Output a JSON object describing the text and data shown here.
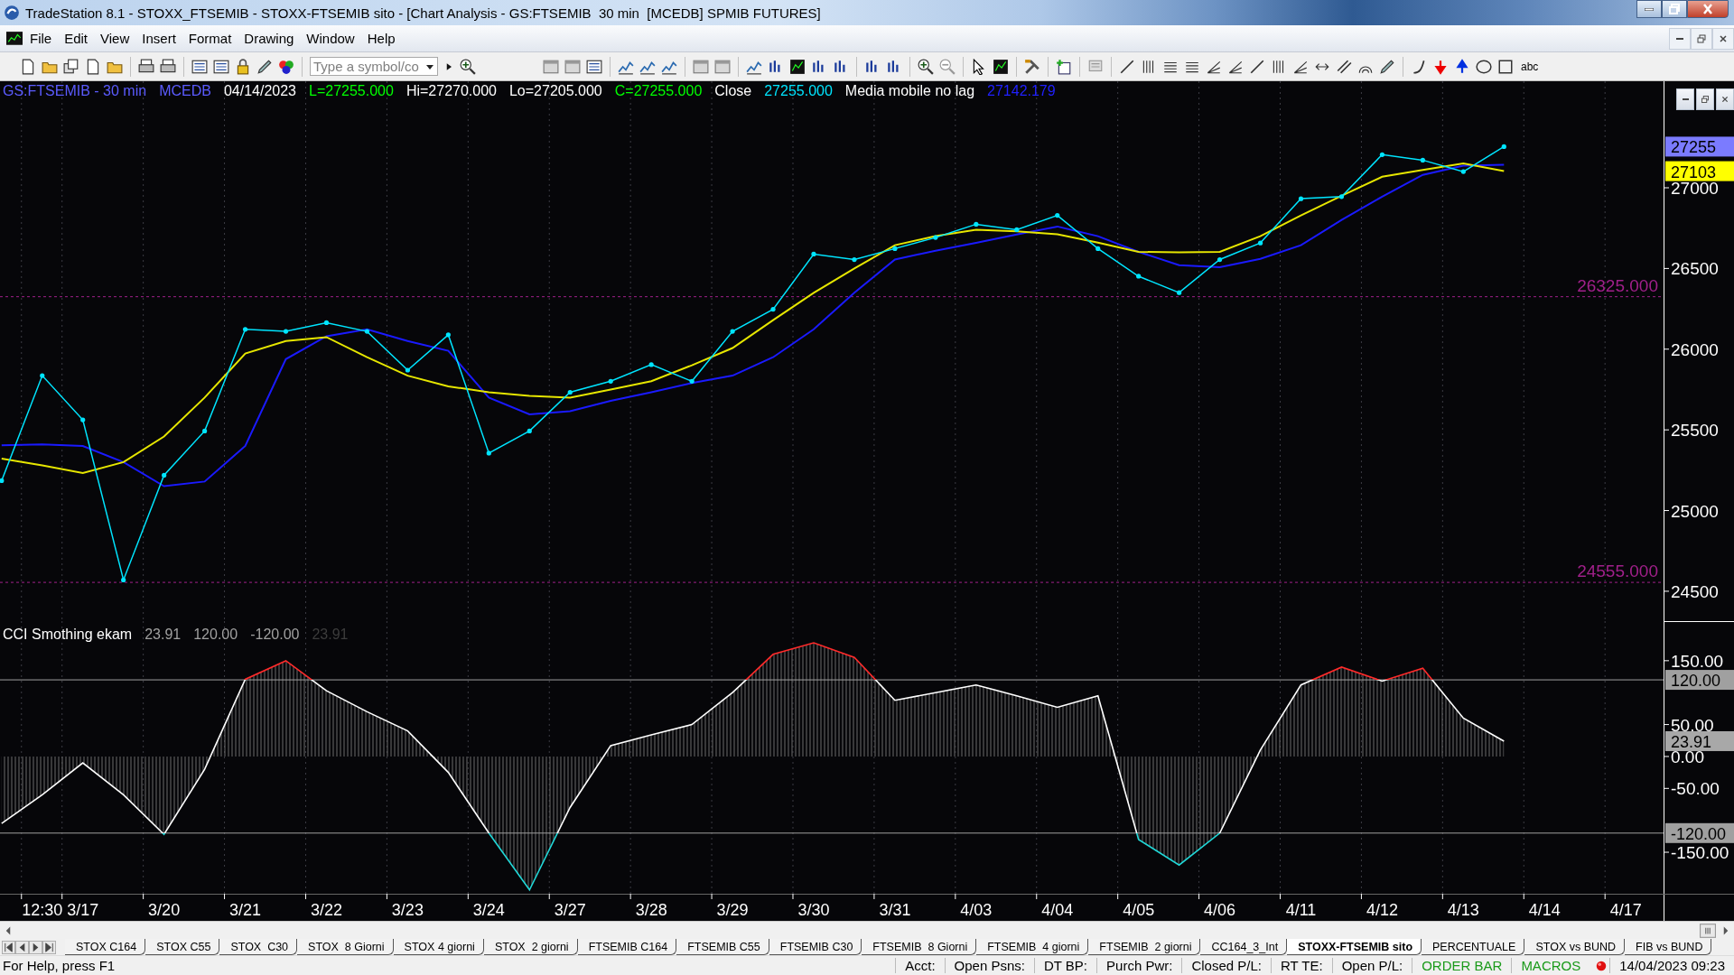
{
  "window": {
    "title": "TradeStation 8.1 - STOXX_FTSEMIB - STOXX-FTSEMIB sito - [Chart Analysis - GS:FTSEMIB  30 min  [MCEDB] SPMIB FUTURES]"
  },
  "menu": [
    "File",
    "Edit",
    "View",
    "Insert",
    "Format",
    "Drawing",
    "Window",
    "Help"
  ],
  "toolbar": {
    "symbol_field": {
      "placeholder": "Type a symbol/co"
    },
    "text_tool": "abc"
  },
  "price_panel": {
    "header": [
      {
        "text": "GS:FTSEMIB - 30 min",
        "color": "#5b5bff"
      },
      {
        "text": "MCEDB",
        "color": "#5b5bff"
      },
      {
        "text": "04/14/2023",
        "color": "#ffffff"
      },
      {
        "text": "L=27255.000",
        "color": "#00ff00"
      },
      {
        "text": "Hi=27270.000",
        "color": "#ffffff"
      },
      {
        "text": "Lo=27205.000",
        "color": "#ffffff"
      },
      {
        "text": "C=27255.000",
        "color": "#00ff00"
      },
      {
        "text": "Close",
        "color": "#ffffff"
      },
      {
        "text": "27255.000",
        "color": "#00e5ff"
      },
      {
        "text": "Media mobile no lag",
        "color": "#ffffff"
      },
      {
        "text": "27142.179",
        "color": "#2020ff"
      }
    ],
    "value_badges": [
      {
        "text": "27255",
        "color": "#7b7bff"
      },
      {
        "text": "27103",
        "color": "#ffff00"
      }
    ],
    "chart_data": {
      "type": "line",
      "ylim": [
        24315,
        27660
      ],
      "yticks": [
        24500,
        25000,
        25500,
        26000,
        26500,
        27000
      ],
      "categories": [
        null,
        null,
        null,
        null,
        null,
        null,
        null,
        null,
        null,
        null,
        null,
        null,
        null,
        null,
        null,
        null,
        null,
        null,
        null,
        null,
        null,
        null,
        null,
        null,
        null,
        null,
        null,
        null,
        null,
        null,
        null,
        null,
        null,
        null,
        null,
        null,
        null,
        null,
        null,
        null,
        null
      ],
      "series": [
        {
          "color": "#00e5ff",
          "values": [
            25185,
            25836,
            25562,
            24570,
            25219,
            25493,
            26123,
            26110,
            26164,
            26110,
            25870,
            26089,
            25356,
            25493,
            25733,
            25801,
            25904,
            25801,
            26110,
            26247,
            26589,
            26555,
            26623,
            26692,
            26774,
            26740,
            26829,
            26623,
            26452,
            26350,
            26555,
            26658,
            26932,
            26945,
            27205,
            27171,
            27100,
            27255,
            null,
            null,
            null
          ]
        },
        {
          "color": "#e6e600",
          "values": [
            25322,
            25280,
            25233,
            25300,
            25459,
            25700,
            25973,
            26050,
            26075,
            25950,
            25836,
            25770,
            25733,
            25710,
            25699,
            25750,
            25801,
            25900,
            26007,
            26180,
            26349,
            26500,
            26644,
            26700,
            26740,
            26730,
            26712,
            26660,
            26603,
            26600,
            26603,
            26700,
            26829,
            26950,
            27068,
            27110,
            27151,
            27103,
            null,
            null,
            null
          ]
        },
        {
          "color": "#1a1aff",
          "values": [
            25404,
            25410,
            25400,
            25300,
            25151,
            25180,
            25400,
            25938,
            26080,
            26123,
            26050,
            25990,
            25700,
            25596,
            25616,
            25680,
            25733,
            25790,
            25836,
            25950,
            26123,
            26350,
            26555,
            26610,
            26658,
            26710,
            26760,
            26700,
            26603,
            26520,
            26507,
            26560,
            26644,
            26800,
            26945,
            27080,
            27137,
            27142,
            null,
            null,
            null
          ]
        }
      ],
      "ref_lines": [
        {
          "axis": "y",
          "value": 26325,
          "label": "26325.000",
          "color": "#a0208a"
        },
        {
          "axis": "y",
          "value": 24555,
          "label": "24555.000",
          "color": "#a0208a"
        }
      ]
    }
  },
  "cci_panel": {
    "header": [
      {
        "text": "CCI Smothing ekam",
        "color": "#ffffff"
      },
      {
        "text": "23.91",
        "color": "#a0a0a0"
      },
      {
        "text": "120.00",
        "color": "#a0a0a0"
      },
      {
        "text": "-120.00",
        "color": "#a0a0a0"
      },
      {
        "text": "23.91",
        "color": "#3c3c3c"
      }
    ],
    "value_badges": [
      {
        "text": "23.91",
        "color": "#a8a8a8"
      }
    ],
    "chart_data": {
      "type": "area",
      "ylim": [
        -215,
        212
      ],
      "categories": [
        null,
        "12:30",
        "3/17",
        null,
        "3/20",
        null,
        "3/21",
        null,
        "3/22",
        null,
        "3/23",
        null,
        "3/24",
        null,
        "3/27",
        null,
        "3/28",
        null,
        "3/29",
        null,
        "3/30",
        null,
        "3/31",
        null,
        "4/03",
        null,
        "4/04",
        null,
        "4/05",
        null,
        "4/06",
        null,
        "4/11",
        null,
        "4/12",
        null,
        "4/13",
        null,
        "4/14",
        null,
        "4/17"
      ],
      "yticks": [
        {
          "value": 150,
          "label": "150.00"
        },
        {
          "value": 50,
          "label": "50.00"
        },
        {
          "value": 0,
          "label": "0.00"
        },
        {
          "value": -50,
          "label": "-50.00"
        },
        {
          "value": -150,
          "label": "-150.00"
        }
      ],
      "series": [
        {
          "color": "#ffffff",
          "values": [
            -105,
            -60,
            -10,
            -60,
            -122,
            -20,
            121,
            150,
            103,
            70,
            40,
            -25,
            -120,
            -209,
            -80,
            17,
            34,
            50,
            100,
            160,
            178,
            155,
            88,
            100,
            112,
            95,
            77,
            95,
            -130,
            -170,
            -120,
            10,
            112,
            140,
            118,
            138,
            60,
            24,
            null,
            null,
            null
          ]
        }
      ],
      "ref_lines": [
        {
          "axis": "y",
          "value": 120,
          "label": "120.00",
          "color": "#a0a0a0"
        },
        {
          "axis": "y",
          "value": -120,
          "label": "-120.00",
          "color": "#a0a0a0"
        }
      ]
    }
  },
  "sheet_tabs": [
    {
      "label": "STOX C164",
      "selected": false
    },
    {
      "label": "STOX C55",
      "selected": false
    },
    {
      "label": "STOX  C30",
      "selected": false
    },
    {
      "label": "STOX  8 Giorni",
      "selected": false
    },
    {
      "label": "STOX 4 giorni",
      "selected": false
    },
    {
      "label": "STOX  2 giorni",
      "selected": false
    },
    {
      "label": "FTSEMIB C164",
      "selected": false
    },
    {
      "label": "FTSEMIB C55",
      "selected": false
    },
    {
      "label": "FTSEMIB C30",
      "selected": false
    },
    {
      "label": "FTSEMIB  8 Giorni",
      "selected": false
    },
    {
      "label": "FTSEMIB  4 giorni",
      "selected": false
    },
    {
      "label": "FTSEMIB  2 giorni",
      "selected": false
    },
    {
      "label": "CC164_3_Int",
      "selected": false
    },
    {
      "label": "STOXX-FTSEMIB sito",
      "selected": true
    },
    {
      "label": "PERCENTUALE",
      "selected": false
    },
    {
      "label": "STOX vs BUND",
      "selected": false
    },
    {
      "label": "FIB vs BUND",
      "selected": false
    }
  ],
  "status_bar": {
    "help": "For Help, press F1",
    "fields": [
      {
        "text": "Acct:",
        "color": "#000000"
      },
      {
        "text": "Open Psns:",
        "color": "#000000"
      },
      {
        "text": "DT BP:",
        "color": "#000000"
      },
      {
        "text": "Purch Pwr:",
        "color": "#000000"
      },
      {
        "text": "Closed P/L:",
        "color": "#000000"
      },
      {
        "text": "RT TE:",
        "color": "#000000"
      },
      {
        "text": "Open P/L:",
        "color": "#000000"
      },
      {
        "text": "ORDER BAR",
        "color": "#1a9a1a"
      },
      {
        "text": "MACROS",
        "color": "#1a9a1a"
      }
    ],
    "datetime": "14/04/2023 09:23"
  }
}
